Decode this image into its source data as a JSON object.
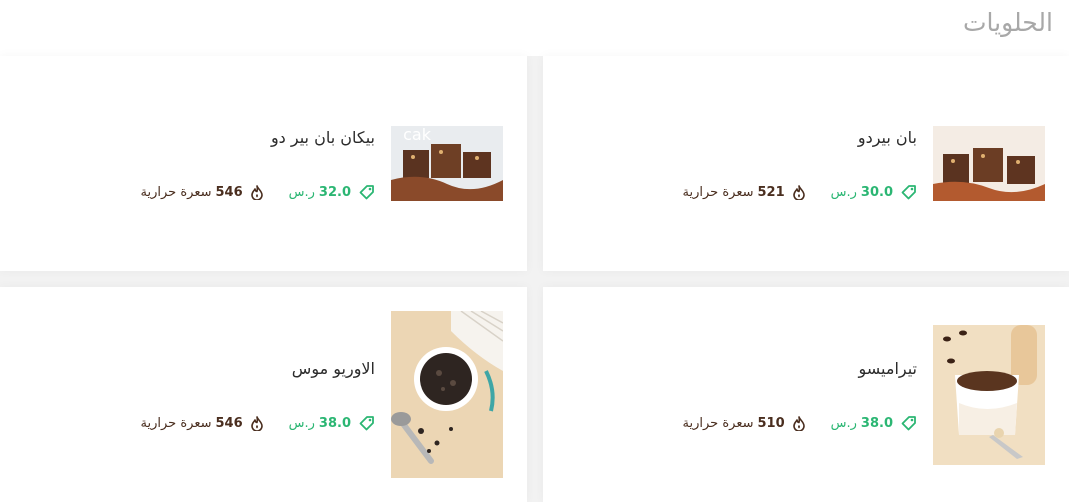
{
  "section": {
    "title": "الحلويات"
  },
  "colors": {
    "price": "#2bb673",
    "calories": "#4a2e1f",
    "title": "#a8a8a8"
  },
  "items": [
    {
      "name": "بان بيردو",
      "price": "30.0",
      "currency": "ر.س",
      "calories": "521",
      "calories_unit": "سعرة حرارية",
      "image": "dessert-bars-photo",
      "price_icon": "tag-icon",
      "calories_icon": "flame-icon"
    },
    {
      "name": "بيكان بان بير دو",
      "price": "32.0",
      "currency": "ر.س",
      "calories": "546",
      "calories_unit": "سعرة حرارية",
      "image": "dessert-bars-photo",
      "price_icon": "tag-icon",
      "calories_icon": "flame-icon"
    },
    {
      "name": "تيراميسو",
      "price": "38.0",
      "currency": "ر.س",
      "calories": "510",
      "calories_unit": "سعرة حرارية",
      "image": "tiramisu-photo",
      "price_icon": "tag-icon",
      "calories_icon": "flame-icon"
    },
    {
      "name": "الاوريو موس",
      "price": "38.0",
      "currency": "ر.س",
      "calories": "546",
      "calories_unit": "سعرة حرارية",
      "image": "oreo-mousse-photo",
      "price_icon": "tag-icon",
      "calories_icon": "flame-icon"
    }
  ]
}
